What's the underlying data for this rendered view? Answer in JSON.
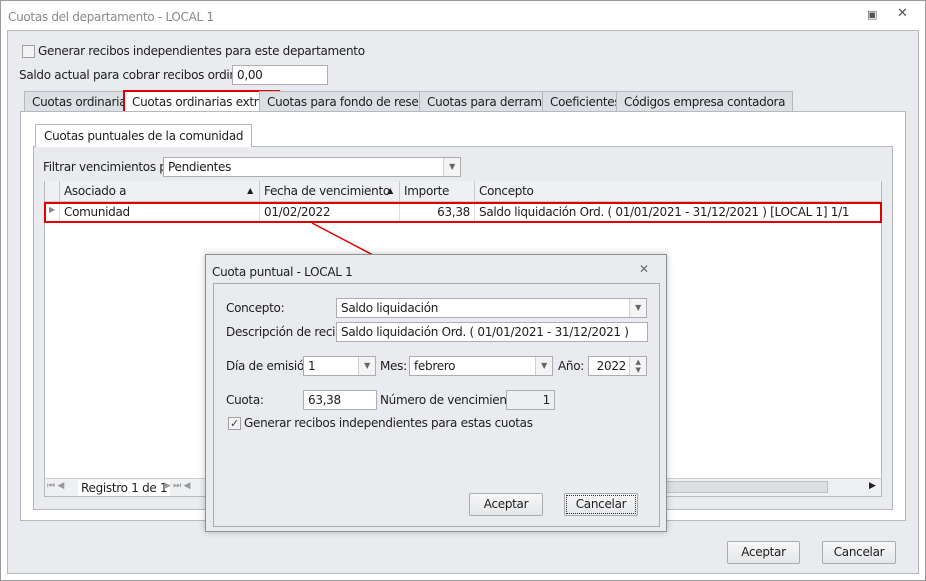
{
  "window": {
    "title": "Cuotas del departamento - LOCAL 1"
  },
  "top": {
    "generar_label": "Generar recibos independientes para este departamento",
    "saldo_label": "Saldo actual para cobrar recibos ordinarios:",
    "saldo_value": "0,00"
  },
  "tabs": [
    {
      "label": "Cuotas ordinarias"
    },
    {
      "label": "Cuotas ordinarias extras"
    },
    {
      "label": "Cuotas para fondo de reserva"
    },
    {
      "label": "Cuotas para derramas"
    },
    {
      "label": "Coeficientes"
    },
    {
      "label": "Códigos empresa contadora"
    }
  ],
  "inner_tab": "Cuotas puntuales de la comunidad",
  "filter": {
    "label": "Filtrar vencimientos por:",
    "value": "Pendientes"
  },
  "grid": {
    "columns": [
      "Asociado a",
      "Fecha de vencimiento",
      "Importe",
      "Concepto"
    ],
    "rows": [
      {
        "asociado": "Comunidad",
        "fecha": "01/02/2022",
        "importe": "63,38",
        "concepto": "Saldo liquidación Ord. ( 01/01/2021 - 31/12/2021 ) [LOCAL 1]  1/1"
      }
    ],
    "nav": "Registro 1 de 1"
  },
  "footer": {
    "ok": "Aceptar",
    "cancel": "Cancelar"
  },
  "dialog": {
    "title": "Cuota puntual - LOCAL 1",
    "concepto_label": "Concepto:",
    "concepto_value": "Saldo liquidación",
    "desc_label": "Descripción de recibo:",
    "desc_value": "Saldo liquidación Ord. ( 01/01/2021 - 31/12/2021 )",
    "dia_label": "Día de emisión:",
    "dia_value": "1",
    "mes_label": "Mes:",
    "mes_value": "febrero",
    "anio_label": "Año:",
    "anio_value": "2022",
    "cuota_label": "Cuota:",
    "cuota_value": "63,38",
    "num_label": "Número de vencimientos:",
    "num_value": "1",
    "generar_label": "Generar recibos independientes para estas cuotas",
    "ok": "Aceptar",
    "cancel": "Cancelar"
  },
  "colors": {
    "highlight": "#e00000"
  }
}
